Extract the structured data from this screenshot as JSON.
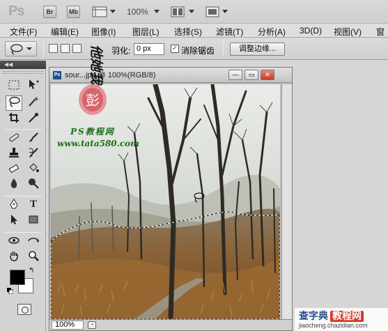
{
  "app": {
    "logo": "Ps",
    "bridge_label": "Br",
    "minibridge_label": "Mb",
    "zoom_level": "100%"
  },
  "menu": {
    "items": [
      {
        "label": "文件(F)"
      },
      {
        "label": "编辑(E)"
      },
      {
        "label": "图像(I)"
      },
      {
        "label": "图层(L)"
      },
      {
        "label": "选择(S)"
      },
      {
        "label": "滤镜(T)"
      },
      {
        "label": "分析(A)"
      },
      {
        "label": "3D(D)"
      },
      {
        "label": "视图(V)"
      },
      {
        "label": "窗"
      }
    ]
  },
  "options": {
    "feather_label": "羽化:",
    "feather_value": "0 px",
    "antialias_label": "消除锯齿",
    "antialias_checked": true,
    "refine_edge_label": "调整边缘..."
  },
  "tools": {
    "foreground_color": "#000000",
    "background_color": "#ffffff",
    "active_tool": "lasso-tool"
  },
  "document": {
    "title": "sour...jpg @ 100%(RGB/8)",
    "status_zoom": "100%"
  },
  "watermark": {
    "calligraphy": "他她我帮你",
    "seal": "彭",
    "brand": "PS教程网",
    "url": "www.tata580.com"
  },
  "corner_badge": {
    "title_left": "查字典",
    "title_right": "教程网",
    "url": "jiaocheng.chazidian.com"
  }
}
